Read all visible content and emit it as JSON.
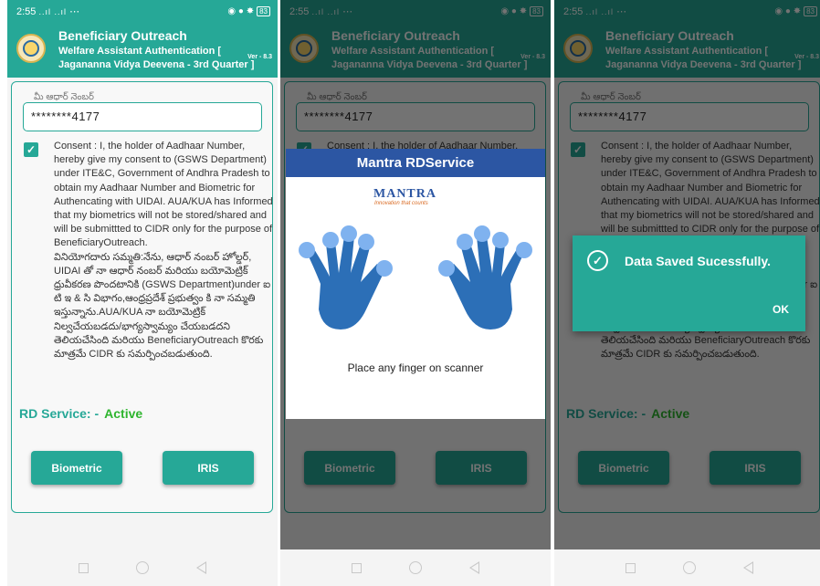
{
  "status": {
    "time": "2:55",
    "signal": "..ıl ..ıl",
    "extra": "⋯",
    "icons": "◉ ● ✸",
    "battery": "83"
  },
  "app": {
    "title": "Beneficiary Outreach",
    "subtitle": "Welfare Assistant Authentication [ Jagananna Vidya Deevena - 3rd Quarter ]",
    "version": "Ver - 8.3"
  },
  "form": {
    "aadhaar_label": "మీ ఆధార్ నెంబర్",
    "aadhaar_value": "********4177",
    "consent_en": "Consent : I, the holder of Aadhaar Number, hereby give my consent to (GSWS Department) under ITE&C, Government of Andhra Pradesh to obtain my Aadhaar Number and Biometric for Authencating with UIDAI. AUA/KUA has Informed that my biometrics will not be stored/shared and will be submittted to CIDR only for the purpose of BeneficiaryOutreach.",
    "consent_te": "వినియోగదారు సమ్మతి:నేను, ఆధార్ నంబర్ హోల్డర్, UIDAI తో నా ఆధార్ నంబర్ మరియు బయోమెట్రిక్ ధ్రువీకరణ పొందటానికి (GSWS Department)under ఐ టి ఇ & సి విభాగం,ఆంధ్రప్రదేశ్ ప్రభుత్వం కి నా సమ్మతి ఇస్తున్నాను.AUA/KUA నా బయోమెట్రిక్ నిల్వచేయబడదు/భాగ్యస్వామ్యం చేయబడదని తెలియచేసింది మరియు BeneficiaryOutreach కొరకు మాత్రమే CIDR కు సమర్పించబడుతుంది.",
    "rd_label": "RD Service: -",
    "rd_status": "Active",
    "biometric_button": "Biometric",
    "iris_button": "IRIS"
  },
  "rd_dialog": {
    "title": "Mantra RDService",
    "logo_text": "MANTRA",
    "logo_tagline": "Innovation that counts",
    "message": "Place any finger on scanner"
  },
  "toast": {
    "message": "Data Saved Sucessfully.",
    "ok_label": "OK"
  },
  "colors": {
    "primary": "#26a897",
    "dialog_header": "#2c56a3",
    "active": "#2fb52f",
    "hand": "#2c6fb7",
    "fingertip": "#7fb2ef"
  }
}
